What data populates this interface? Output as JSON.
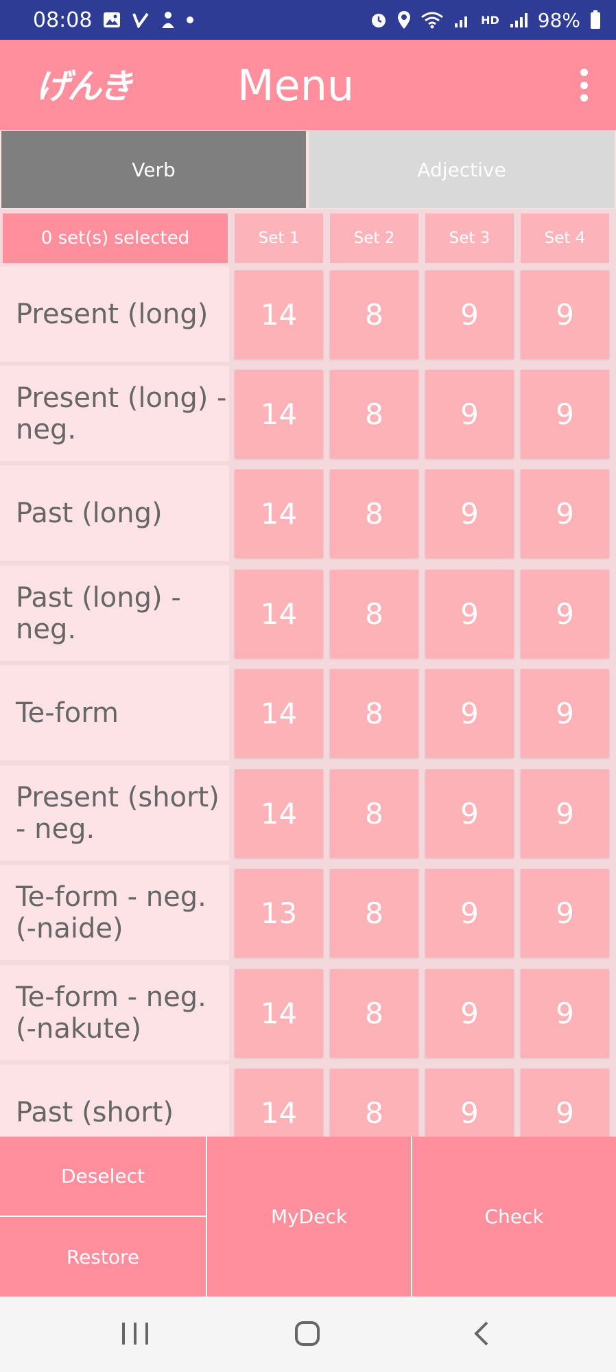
{
  "status_bar": {
    "time": "08:08",
    "battery": "98%",
    "network": "HD"
  },
  "app_bar": {
    "logo_text": "げんき",
    "title": "Menu"
  },
  "tabs": [
    {
      "label": "Verb",
      "selected": true
    },
    {
      "label": "Adjective",
      "selected": false
    }
  ],
  "grid": {
    "selected_text": "0 set(s) selected",
    "sets": [
      "Set 1",
      "Set 2",
      "Set 3",
      "Set 4"
    ],
    "rows": [
      {
        "label": "Present (long)",
        "values": [
          "14",
          "8",
          "9",
          "9"
        ]
      },
      {
        "label": "Present (long) - neg.",
        "values": [
          "14",
          "8",
          "9",
          "9"
        ]
      },
      {
        "label": "Past (long)",
        "values": [
          "14",
          "8",
          "9",
          "9"
        ]
      },
      {
        "label": "Past (long) - neg.",
        "values": [
          "14",
          "8",
          "9",
          "9"
        ]
      },
      {
        "label": "Te-form",
        "values": [
          "14",
          "8",
          "9",
          "9"
        ]
      },
      {
        "label": "Present (short) - neg.",
        "values": [
          "14",
          "8",
          "9",
          "9"
        ]
      },
      {
        "label": "Te-form - neg. (-naide)",
        "values": [
          "13",
          "8",
          "9",
          "9"
        ]
      },
      {
        "label": "Te-form - neg. (-nakute)",
        "values": [
          "14",
          "8",
          "9",
          "9"
        ]
      },
      {
        "label": "Past (short)",
        "values": [
          "14",
          "8",
          "9",
          "9"
        ]
      }
    ]
  },
  "buttons": {
    "deselect": "Deselect",
    "restore": "Restore",
    "mydeck": "MyDeck",
    "check": "Check"
  },
  "colors": {
    "status_bar": "#2f3c95",
    "primary": "#ff8f9c",
    "cell": "#fdb2b8",
    "row_bg": "#fde3e6",
    "tab_selected": "#7f7f7f",
    "tab_unselected": "#d9d9d9"
  }
}
